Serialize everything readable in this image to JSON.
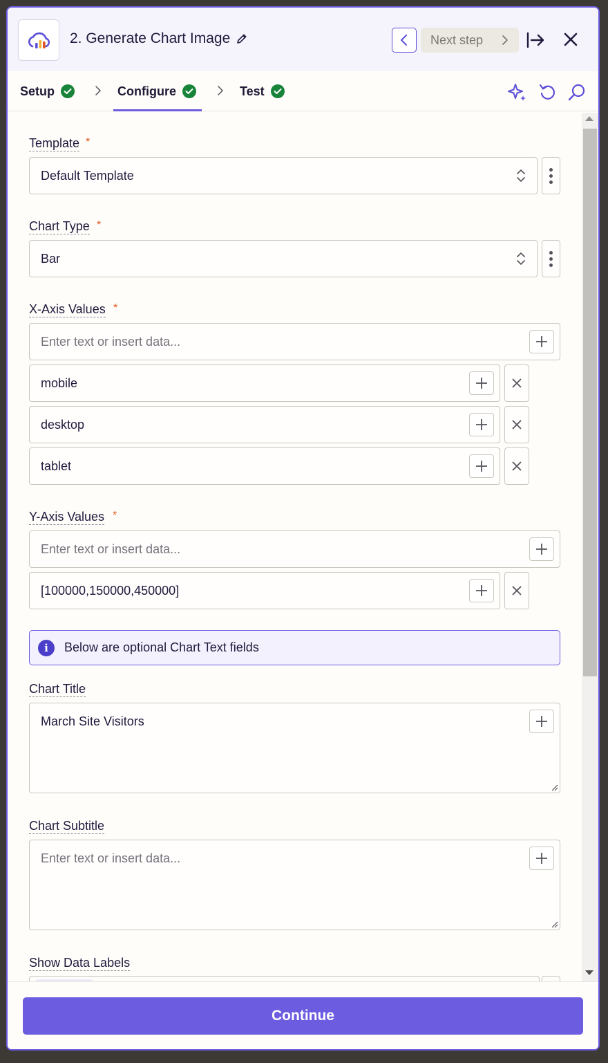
{
  "header": {
    "title": "2. Generate Chart Image",
    "next_label": "Next step",
    "icons": [
      "chart-cloud-app-icon",
      "pencil-icon",
      "chevron-left-icon",
      "chevron-right-icon",
      "dock-right-icon",
      "close-icon"
    ]
  },
  "tabs": [
    {
      "label": "Setup",
      "status": "complete"
    },
    {
      "label": "Configure",
      "status": "complete",
      "active": true
    },
    {
      "label": "Test",
      "status": "complete"
    }
  ],
  "toolbar_icons": [
    "sparkle-icon",
    "undo-icon",
    "search-icon"
  ],
  "fields": {
    "template": {
      "label": "Template",
      "required_mark": "*",
      "value": "Default Template"
    },
    "chart_type": {
      "label": "Chart Type",
      "required_mark": "*",
      "value": "Bar"
    },
    "x_axis": {
      "label": "X-Axis Values",
      "required_mark": "*",
      "placeholder": "Enter text or insert data...",
      "items": [
        "mobile",
        "desktop",
        "tablet"
      ]
    },
    "y_axis": {
      "label": "Y-Axis Values",
      "required_mark": "*",
      "placeholder": "Enter text or insert data...",
      "items": [
        "[100000,150000,450000]"
      ]
    },
    "info": "Below are optional Chart Text fields",
    "chart_title": {
      "label": "Chart Title",
      "value": "March Site Visitors"
    },
    "chart_subtitle": {
      "label": "Chart Subtitle",
      "placeholder": "Enter text or insert data..."
    },
    "show_data_labels": {
      "label": "Show Data Labels"
    }
  },
  "footer": {
    "continue_label": "Continue"
  },
  "colors": {
    "accent": "#6b5ce0",
    "success": "#17843a",
    "required": "#e0561f"
  }
}
